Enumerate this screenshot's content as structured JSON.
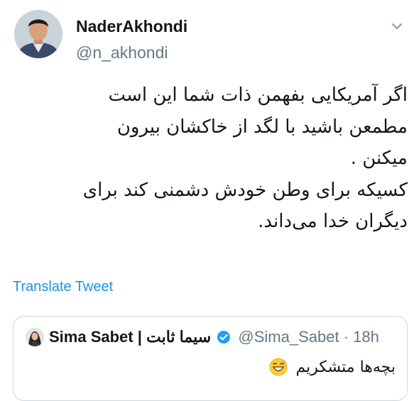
{
  "tweet": {
    "display_name": "NaderAkhondi",
    "handle": "@n_akhondi",
    "text_lines": [
      "اگر آمریکایی  بفهمن ذات شما این است",
      "مطمعن  باشید با لگد از خاکشان بیرون",
      "میکنن .",
      "کسیکه برای  وطن خودش دشمنی کند برای",
      "دیگران خدا می‌داند."
    ],
    "translate_label": "Translate Tweet"
  },
  "quoted_tweet": {
    "name": "Sima Sabet | سیما ثابت",
    "handle": "@Sima_Sabet",
    "separator": "·",
    "time": "18h",
    "text": "بچه‌ها متشکریم"
  },
  "icons": {
    "caret": "chevron-down-icon",
    "verified": "verified-badge-icon",
    "emoji": "grinning-sweat-emoji-icon"
  },
  "colors": {
    "link": "#1b95e0",
    "secondary_text": "#657786",
    "verified": "#1da1f2",
    "border": "#ccd6dd"
  }
}
